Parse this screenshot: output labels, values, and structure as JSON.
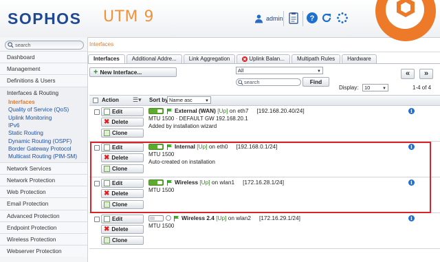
{
  "header": {
    "logo": "SOPHOS",
    "product": "UTM 9",
    "user": "admin",
    "icons": [
      "user-icon",
      "clipboard-icon",
      "help-icon",
      "refresh-icon",
      "spinner-icon"
    ]
  },
  "sidebar": {
    "search_placeholder": "search",
    "items": [
      {
        "label": "Dashboard"
      },
      {
        "label": "Management"
      },
      {
        "label": "Definitions & Users"
      },
      {
        "label": "Interfaces & Routing"
      }
    ],
    "subitems": [
      "Interfaces",
      "Quality of Service (QoS)",
      "Uplink Monitoring",
      "IPv6",
      "Static Routing",
      "Dynamic Routing (OSPF)",
      "Border Gateway Protocol",
      "Multicast Routing (PIM-SM)"
    ],
    "items_after": [
      {
        "label": "Network Services"
      },
      {
        "label": "Network Protection"
      },
      {
        "label": "Web Protection"
      },
      {
        "label": "Email Protection"
      },
      {
        "label": "Advanced Protection"
      },
      {
        "label": "Endpoint Protection"
      },
      {
        "label": "Wireless Protection"
      },
      {
        "label": "Webserver Protection"
      }
    ]
  },
  "main": {
    "breadcrumb": "Interfaces",
    "tabs": [
      "Interfaces",
      "Additional Addre...",
      "Link Aggregation",
      "Uplink Balan...",
      "Multipath Rules",
      "Hardware"
    ],
    "new_button": "New Interface...",
    "filter_value": "All",
    "search_placeholder": "search",
    "find_button": "Find",
    "prev_symbol": "«",
    "next_symbol": "»",
    "display_label": "Display:",
    "display_value": "10",
    "range": "1-4 of 4",
    "table": {
      "action_header": "Action",
      "sortby_label": "Sort by:",
      "sortby_value": "Name asc",
      "button_labels": {
        "edit": "Edit",
        "delete": "Delete",
        "clone": "Clone"
      },
      "rows": [
        {
          "name": "External (WAN)",
          "status": "[Up]",
          "device": "on eth7",
          "address": "[192.168.20.40/24]",
          "line2": "MTU 1500 · DEFAULT GW 192.168.20.1",
          "line3": "Added by installation wizard"
        },
        {
          "name": "Internal",
          "status": "[Up]",
          "device": "on eth0",
          "address": "[192.168.0.1/24]",
          "line2": "MTU 1500",
          "line3": "Auto-created on installation"
        },
        {
          "name": "Wireless",
          "status": "[Up]",
          "device": "on wlan1",
          "address": "[172.16.28.1/24]",
          "line2": "MTU 1500",
          "line3": ""
        },
        {
          "name": "Wireless 2.4",
          "status": "[Up]",
          "device": "on wlan2",
          "address": "[172.16.29.1/24]",
          "line2": "MTU 1500",
          "line3": ""
        }
      ]
    }
  },
  "colors": {
    "brand_blue": "#1f4a93",
    "accent_orange": "#e87722",
    "status_green": "#2d8a1e",
    "highlight_red": "#d9232b"
  }
}
